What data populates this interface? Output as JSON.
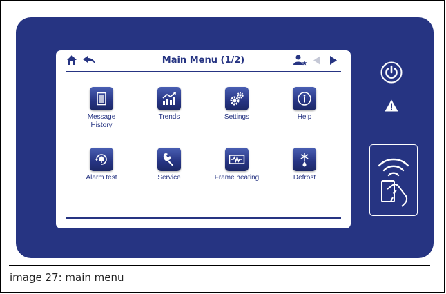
{
  "screen": {
    "title": "Main Menu (1/2)",
    "icons": {
      "home": "home-icon",
      "back": "back-arrow-icon",
      "user": "user-star-icon",
      "prev": "previous-page-icon",
      "next": "next-page-icon"
    },
    "tiles": [
      {
        "label_line1": "Message",
        "label_line2": "History",
        "icon": "document-list-icon"
      },
      {
        "label_line1": "Trends",
        "label_line2": "",
        "icon": "trend-chart-icon"
      },
      {
        "label_line1": "Settings",
        "label_line2": "",
        "icon": "gears-icon"
      },
      {
        "label_line1": "Help",
        "label_line2": "",
        "icon": "info-icon"
      },
      {
        "label_line1": "Alarm test",
        "label_line2": "",
        "icon": "bell-cycle-icon"
      },
      {
        "label_line1": "Service",
        "label_line2": "",
        "icon": "wrench-icon"
      },
      {
        "label_line1": "Frame heating",
        "label_line2": "",
        "icon": "heater-icon"
      },
      {
        "label_line1": "Defrost",
        "label_line2": "",
        "icon": "snowflake-drop-icon"
      }
    ]
  },
  "panel": {
    "power": "power-icon",
    "warning": "warning-icon",
    "reader": "nfc-card-reader-icon"
  },
  "caption": "image 27: main menu",
  "colors": {
    "panel": "#263482",
    "screen": "#ffffff",
    "accent": "#263482"
  }
}
